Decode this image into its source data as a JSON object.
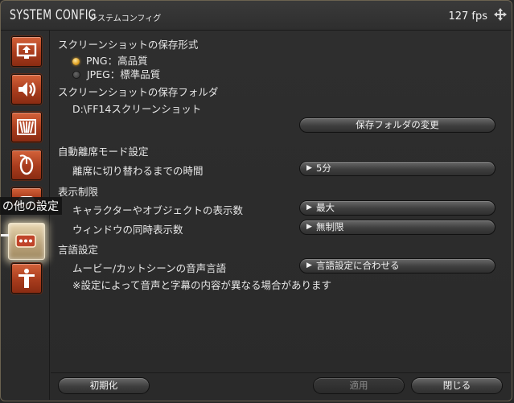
{
  "window": {
    "title": "SYSTEM CONFIG",
    "subtitle": "システムコンフィグ",
    "fps": "127 fps"
  },
  "sidebar": {
    "tooltip": "の他の設定",
    "items": [
      {
        "icon": "display-settings-icon",
        "active": false
      },
      {
        "icon": "sound-icon",
        "active": false
      },
      {
        "icon": "theater-settings-icon",
        "active": false
      },
      {
        "icon": "mouse-icon",
        "active": false
      },
      {
        "icon": "gamepad-icon",
        "active": false
      },
      {
        "icon": "other-settings-icon",
        "active": true
      },
      {
        "icon": "accessibility-icon",
        "active": false
      }
    ]
  },
  "screenshot": {
    "format_heading": "スクリーンショットの保存形式",
    "format_options": [
      {
        "label": "PNG：高品質",
        "selected": true
      },
      {
        "label": "JPEG：標準品質",
        "selected": false
      }
    ],
    "folder_heading": "スクリーンショットの保存フォルダ",
    "folder_path": "D:\\FF14スクリーンショット",
    "change_folder_button": "保存フォルダの変更"
  },
  "afk": {
    "heading": "自動離席モード設定",
    "timeout_label": "離席に切り替わるまでの時間",
    "timeout_value": "5分"
  },
  "display_limits": {
    "heading": "表示制限",
    "objects_label": "キャラクターやオブジェクトの表示数",
    "objects_value": "最大",
    "windows_label": "ウィンドウの同時表示数",
    "windows_value": "無制限"
  },
  "language": {
    "heading": "言語設定",
    "movie_audio_label": "ムービー/カットシーンの音声言語",
    "movie_audio_value": "言語設定に合わせる",
    "note": "※設定によって音声と字幕の内容が異なる場合があります"
  },
  "footer": {
    "reset_button": "初期化",
    "apply_button": "適用",
    "close_button": "閉じる"
  },
  "colors": {
    "category_button": "#b84a26",
    "accent_radio": "#e0a020",
    "window_border": "#6b6250"
  }
}
